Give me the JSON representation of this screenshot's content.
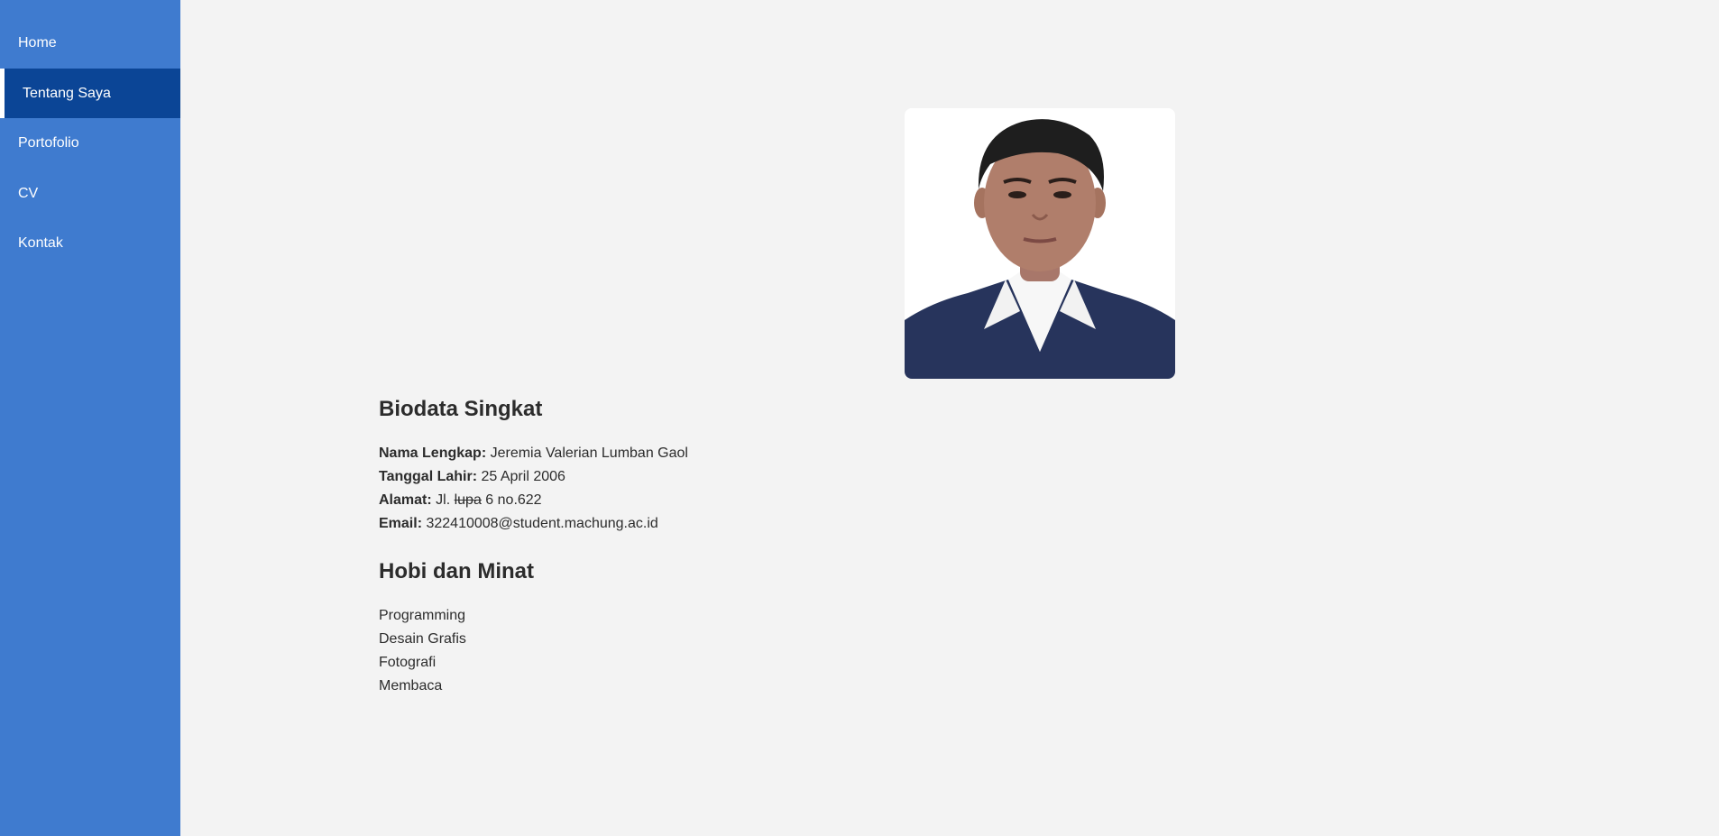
{
  "nav": {
    "items": [
      {
        "label": "Home"
      },
      {
        "label": "Tentang Saya",
        "active": true
      },
      {
        "label": "Portofolio"
      },
      {
        "label": "CV"
      },
      {
        "label": "Kontak"
      }
    ]
  },
  "biodata": {
    "heading": "Biodata Singkat",
    "nama_label": "Nama Lengkap:",
    "nama_value": "Jeremia Valerian Lumban Gaol",
    "tanggal_label": "Tanggal Lahir:",
    "tanggal_value": "25 April 2006",
    "alamat_label": "Alamat:",
    "alamat_prefix": "Jl.",
    "alamat_struck": "lupa",
    "alamat_suffix": "6 no.622",
    "email_label": "Email:",
    "email_value": "322410008@student.machung.ac.id"
  },
  "hobi": {
    "heading": "Hobi dan Minat",
    "items": [
      "Programming",
      "Desain Grafis",
      "Fotografi",
      "Membaca"
    ]
  },
  "colors": {
    "sidebar": "#3f7bcf",
    "sidebar_active": "#0b4596",
    "background": "#f3f3f3",
    "text": "#2c2c2c"
  }
}
